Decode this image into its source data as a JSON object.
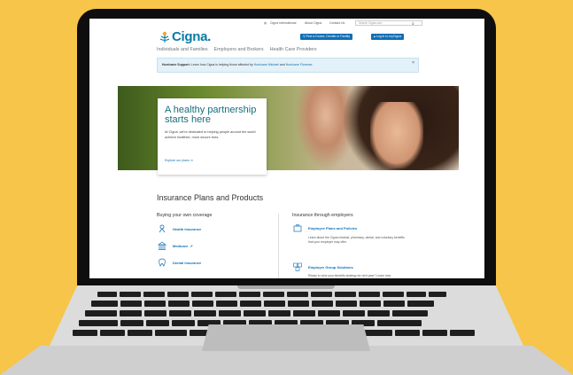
{
  "site": {
    "topbar": {
      "international": "Cigna International",
      "about": "About Cigna",
      "contact": "Contact Us",
      "search_placeholder": "Search Cigna.com"
    },
    "logo_text": "Cigna.",
    "buttons": {
      "find_doctor": "Find a Doctor, Dentist or Facility",
      "login": "Log in to myCigna"
    },
    "nav": [
      "Individuals and Families",
      "Employers and Brokers",
      "Health Care Providers"
    ],
    "alert": {
      "bold": "Hurricane Support:",
      "text": "Learn how Cigna is helping those affected by",
      "link1": "Hurricane Michael",
      "and": "and",
      "link2": "Hurricane Florence."
    },
    "hero": {
      "title": "A healthy partnership starts here",
      "body": "At Cigna, we're dedicated to helping people around the world achieve healthier, more secure lives.",
      "link": "Explore our plans"
    },
    "section_title": "Insurance Plans and Products",
    "own_coverage": {
      "heading": "Buying your own coverage",
      "items": [
        "Health Insurance",
        "Medicare",
        "Dental Insurance"
      ]
    },
    "employers": {
      "heading": "Insurance through employers",
      "items": [
        {
          "title": "Employee Plans and Policies",
          "desc": "Learn about the Cigna medical, pharmacy, dental, and voluntary benefits that your employer may offer."
        },
        {
          "title": "Employer Group Solutions",
          "desc": "Ready to view your benefits strategy for next year? Learn how"
        }
      ]
    }
  },
  "colors": {
    "background": "#f6c54a",
    "brand": "#0a7aa5",
    "button": "#0f6fb5"
  }
}
